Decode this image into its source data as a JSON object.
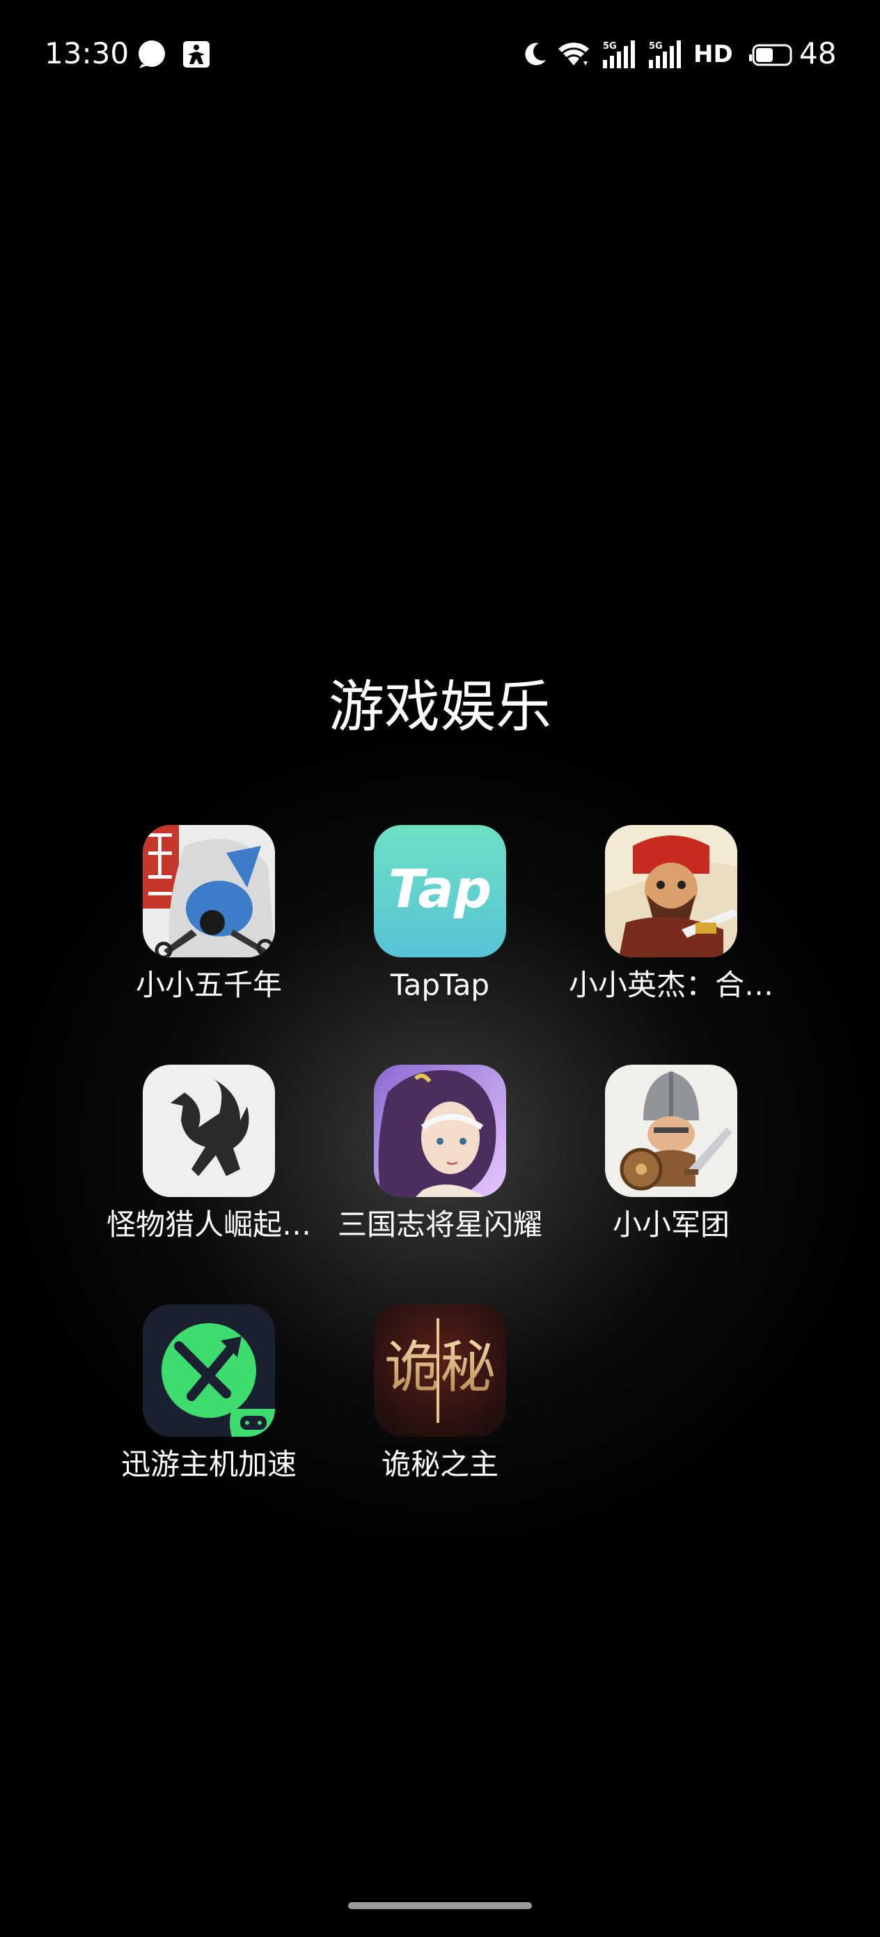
{
  "status_bar": {
    "time": "13:30",
    "notification_icons": [
      "chat-bubble-icon",
      "app-notification-icon"
    ],
    "system_icons": [
      "moon-icon",
      "wifi-icon",
      "signal-5g-icon",
      "signal-5g-icon",
      "hd-icon",
      "battery-icon"
    ],
    "network_label": "5G",
    "hd_label": "HD",
    "battery_level": "48"
  },
  "folder": {
    "title": "游戏娱乐",
    "apps": [
      {
        "label": "小小五千年",
        "icon": "xiaoxiao-wuqiannian-icon"
      },
      {
        "label": "TapTap",
        "icon": "taptap-icon",
        "icon_text": "Tap"
      },
      {
        "label": "小小英杰：合…",
        "icon": "xiaoxiao-yingjie-icon"
      },
      {
        "label": "怪物猎人崛起…",
        "icon": "monster-hunter-icon"
      },
      {
        "label": "三国志将星闪耀",
        "icon": "sanguozhi-icon"
      },
      {
        "label": "小小军团",
        "icon": "xiaoxiao-juntuan-icon"
      },
      {
        "label": "迅游主机加速",
        "icon": "xunyou-icon"
      },
      {
        "label": "诡秘之主",
        "icon": "guimi-zhizhu-icon",
        "icon_text": "诡秘"
      }
    ]
  },
  "colors": {
    "background": "#000000",
    "taptap_teal": "#5cd3c0",
    "xunyou_green": "#3ddc6e"
  }
}
